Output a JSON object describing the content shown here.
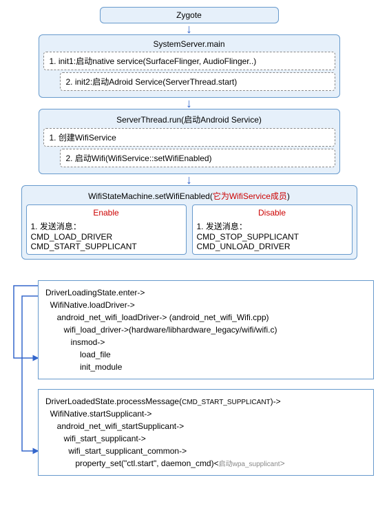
{
  "zygote": "Zygote",
  "systemServer": {
    "title": "SystemServer.main",
    "line1": "1. init1:启动native service(SurfaceFlinger, AudioFlinger..)",
    "line2": "2. init2:启动Adroid Service(ServerThread.start)"
  },
  "serverThread": {
    "title": "ServerThread.run(启动Android Service)",
    "line1": "1. 创建WifiService",
    "line2": "2. 启动Wifi(WifiService::setWifiEnabled)"
  },
  "wifiStateMachine": {
    "titlePrefix": "WifiStateMachine.setWifiEnabled(",
    "titleRed": "它为WifiService成员",
    "titleSuffix": ")",
    "enable": {
      "title": "Enable",
      "line1": "1. 发送消息：",
      "line2": "CMD_LOAD_DRIVER",
      "line3": "CMD_START_SUPPLICANT"
    },
    "disable": {
      "title": "Disable",
      "line1": "1. 发送消息：",
      "line2": "CMD_STOP_SUPPLICANT",
      "line3": "CMD_UNLOAD_DRIVER"
    }
  },
  "driverLoading": {
    "l1": "DriverLoadingState.enter->",
    "l2": "  WifiNative.loadDriver->",
    "l3": "     android_net_wifi_loadDriver-> (android_net_wifi_Wifi.cpp)",
    "l4": "        wifi_load_driver->(hardware/libhardware_legacy/wifi/wifi.c)",
    "l5": "           insmod->",
    "l6": "               load_file",
    "l7": "               init_module"
  },
  "driverLoaded": {
    "l1a": "DriverLoadedState.processMessage(",
    "l1b": "CMD_START_SUPPLICANT",
    "l1c": ")->",
    "l2": "  WifiNative.startSupplicant->",
    "l3": "     android_net_wifi_startSupplicant->",
    "l4": "        wifi_start_supplicant->",
    "l5": "          wifi_start_supplicant_common->",
    "l6a": "             property_set(\"ctl.start\", daemon_cmd)<",
    "l6b": "启动wpa_supplicant",
    "l6c": ">"
  }
}
